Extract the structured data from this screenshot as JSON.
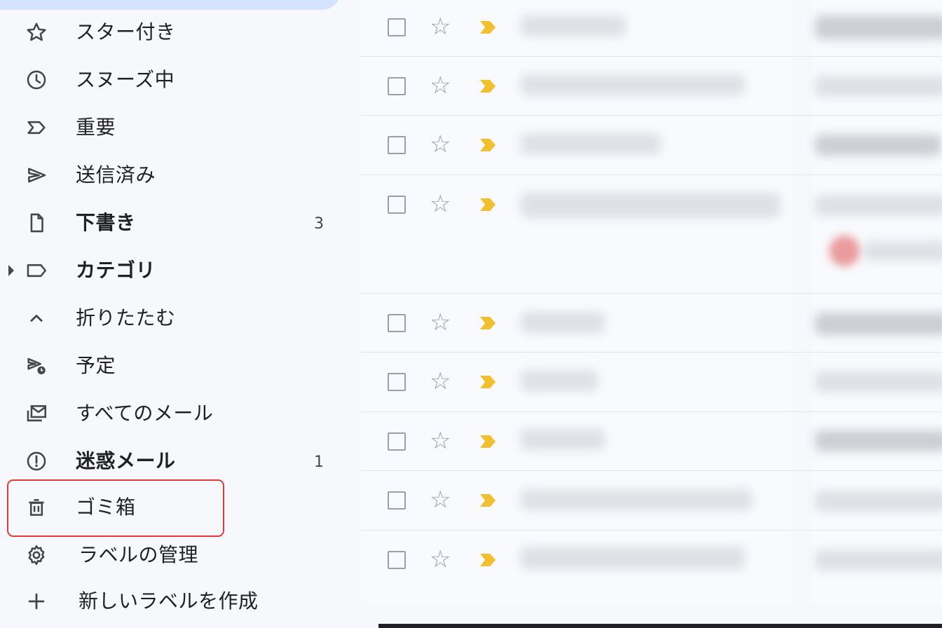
{
  "sidebar": {
    "items": [
      {
        "label": "スター付き",
        "icon": "star-outline-icon"
      },
      {
        "label": "スヌーズ中",
        "icon": "clock-icon"
      },
      {
        "label": "重要",
        "icon": "important-label-icon"
      },
      {
        "label": "送信済み",
        "icon": "send-icon"
      },
      {
        "label": "下書き",
        "icon": "draft-file-icon",
        "count": "3",
        "bold": true
      },
      {
        "label": "カテゴリ",
        "icon": "label-tag-icon",
        "bold": true,
        "expandable": true
      },
      {
        "label": "折りたたむ",
        "icon": "chevron-up-icon"
      },
      {
        "label": "予定",
        "icon": "scheduled-send-icon"
      },
      {
        "label": "すべてのメール",
        "icon": "all-mail-icon"
      },
      {
        "label": "迷惑メール",
        "icon": "spam-report-icon",
        "count": "1",
        "bold": true
      },
      {
        "label": "ゴミ箱",
        "icon": "trash-icon",
        "highlighted": true
      },
      {
        "label": "ラベルの管理",
        "icon": "gear-icon"
      },
      {
        "label": "新しいラベルを作成",
        "icon": "plus-icon"
      }
    ]
  },
  "mail_list": {
    "row_count": 9,
    "star_glyph": "☆",
    "importance_color": "#f2c02e"
  },
  "colors": {
    "highlight_border": "#e53935",
    "active_pill": "#d3e3fd",
    "background": "#f6f8fc"
  }
}
